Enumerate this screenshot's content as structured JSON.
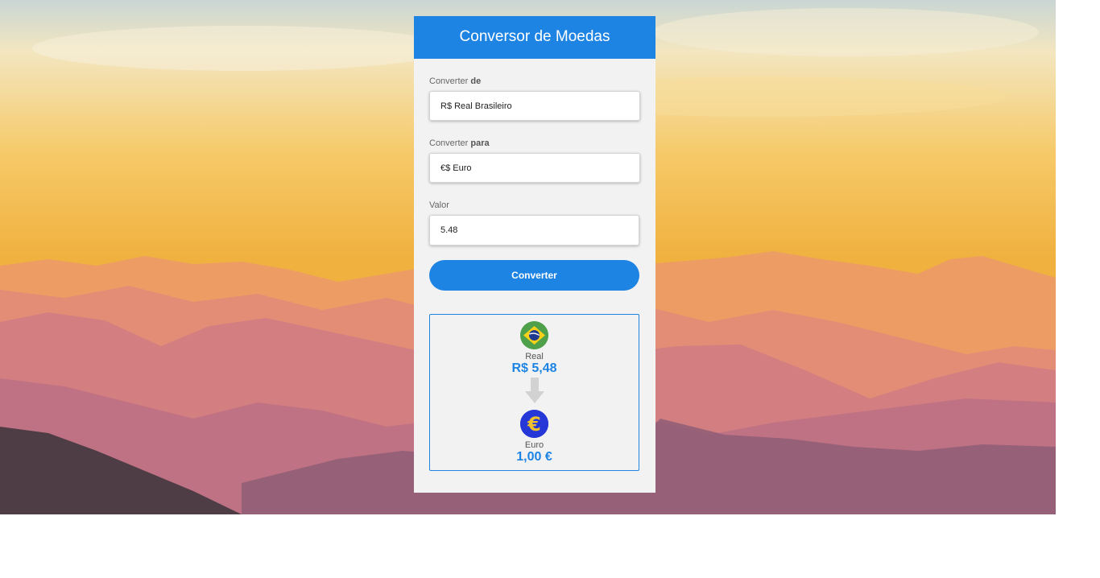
{
  "header": {
    "title": "Conversor de Moedas"
  },
  "from": {
    "label_prefix": "Converter ",
    "label_bold": "de",
    "selected": "R$ Real Brasileiro"
  },
  "to": {
    "label_prefix": "Converter ",
    "label_bold": "para",
    "selected": "€$ Euro"
  },
  "amount": {
    "label": "Valor",
    "value": "5.48"
  },
  "convert_button": {
    "label": "Converter"
  },
  "result": {
    "from_name": "Real",
    "from_amount": "R$ 5,48",
    "to_name": "Euro",
    "to_amount": "1,00 €",
    "from_icon": "brazil-flag-icon",
    "to_icon": "euro-icon",
    "arrow_icon": "arrow-down-icon"
  },
  "colors": {
    "accent": "#1e84e3",
    "card_bg": "#f2f2f2"
  }
}
